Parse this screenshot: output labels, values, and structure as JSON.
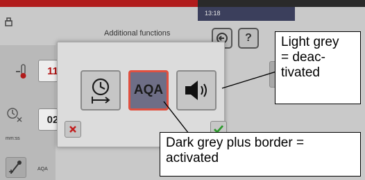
{
  "statusbar": {
    "time": "13:18"
  },
  "header": {
    "title": "Additional functions"
  },
  "left_panel": {
    "temp_value": "11",
    "timer_value": "02",
    "timer_unit": "mm:ss",
    "aqa_label": "AQA"
  },
  "dialog": {
    "timer_button_icon": "clock-arrow-icon",
    "aqa_button_label": "AQA",
    "sound_button_icon": "speaker-icon",
    "cancel_icon": "red-x-icon",
    "confirm_icon": "green-check-icon"
  },
  "annotations": {
    "deactivated": "Light grey\n= deac-\ntivated",
    "activated": "Dark grey plus border =\nactivated"
  },
  "colors": {
    "topbar_red": "#b11c1c",
    "active_button": "#6e6e86",
    "active_border": "#e05040",
    "inactive_button": "#c6c6c6"
  }
}
